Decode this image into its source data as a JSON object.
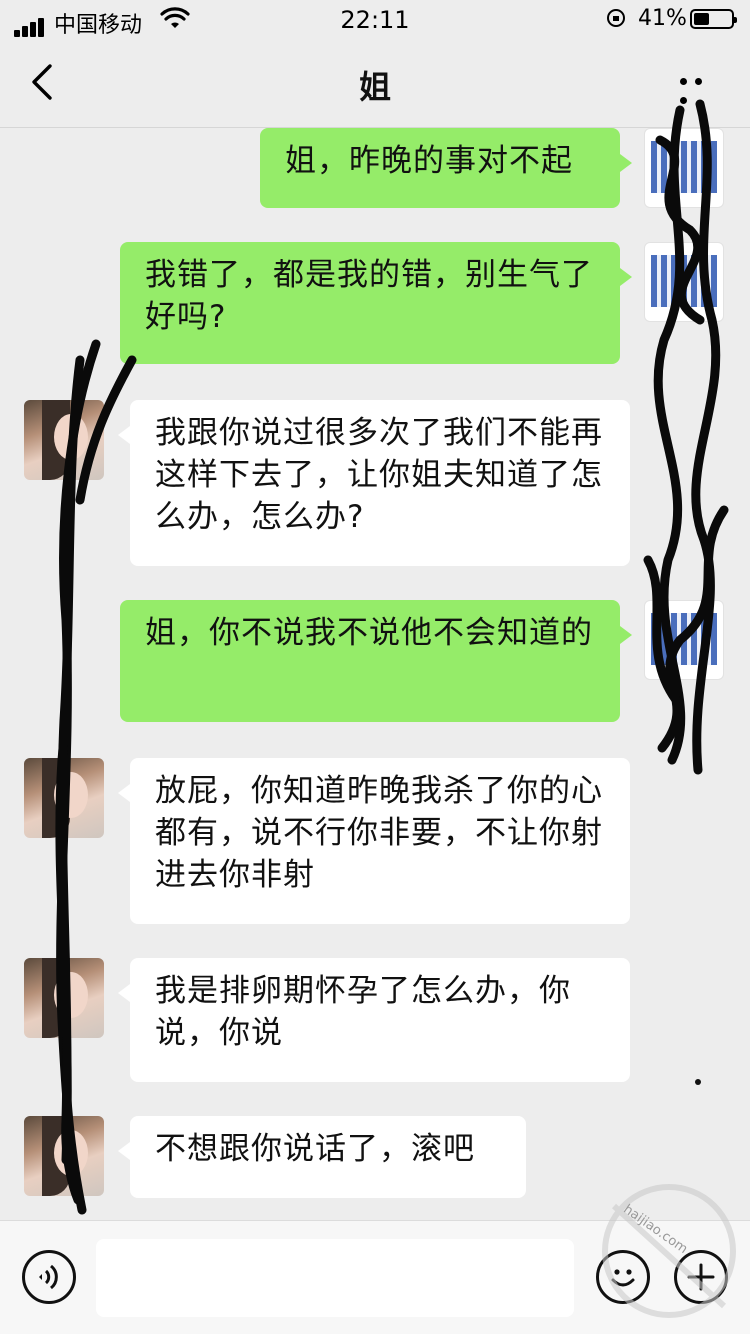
{
  "status_bar": {
    "carrier": "中国移动",
    "time": "22:11",
    "battery": "41%",
    "battery_level": 0.41
  },
  "nav": {
    "title": "姐"
  },
  "messages": [
    {
      "side": "out",
      "text": "姐，昨晚的事对不起"
    },
    {
      "side": "out",
      "text": "我错了，都是我的错，别生气了好吗?"
    },
    {
      "side": "in",
      "text": "我跟你说过很多次了我们不能再这样下去了，让你姐夫知道了怎么办，怎么办?"
    },
    {
      "side": "out",
      "text": "姐，你不说我不说他不会知道的"
    },
    {
      "side": "in",
      "text": "放屁，你知道昨晚我杀了你的心都有，说不行你非要，不让你射进去你非射"
    },
    {
      "side": "in",
      "text": "我是排卵期怀孕了怎么办，你说，你说"
    },
    {
      "side": "in",
      "text": "不想跟你说话了，滚吧"
    }
  ],
  "input": {
    "value": "",
    "placeholder": ""
  },
  "watermark": {
    "text": "haijiao.com"
  },
  "icons": {
    "back": "chevron-left-icon",
    "more": "more-icon",
    "voice": "voice-icon",
    "emoji": "emoji-icon",
    "plus": "plus-icon"
  },
  "colors": {
    "outgoing_bubble": "#95ec69",
    "incoming_bubble": "#ffffff",
    "background": "#ededed"
  }
}
